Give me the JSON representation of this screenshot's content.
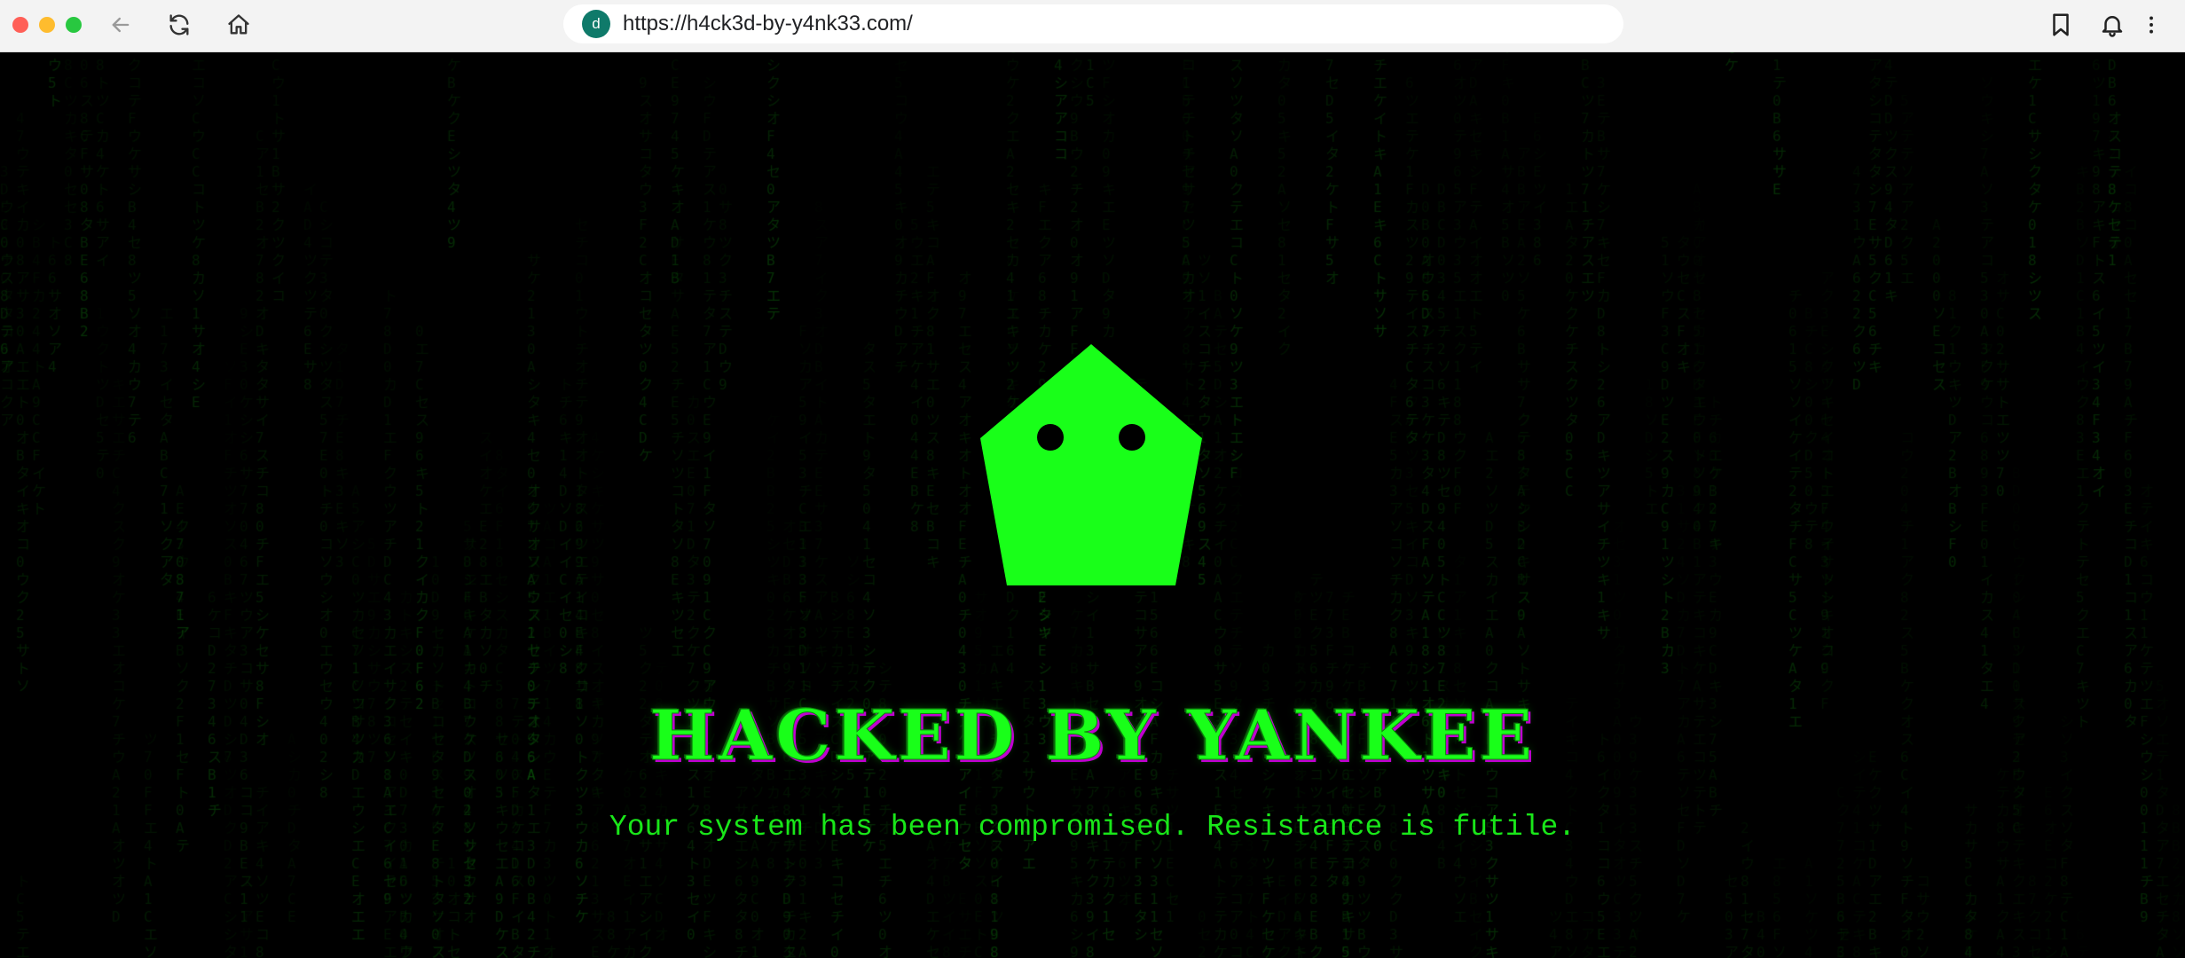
{
  "browser": {
    "address_bar": {
      "favicon_letter": "d",
      "url": "https://h4ck3d-by-y4nk33.com/"
    },
    "icons": {
      "back": "arrow-left-icon",
      "reload": "reload-icon",
      "home": "home-icon",
      "bookmark": "bookmark-icon",
      "notifications": "bell-icon",
      "menu": "more-vertical-icon"
    }
  },
  "page": {
    "headline": "HACKED BY YANKEE",
    "message": "Your system has been compromised. Resistance is futile.",
    "logo_icon": "pentagon-face-icon",
    "colors": {
      "background": "#000000",
      "accent_green": "#19ff19",
      "headline_shadow": "#c000d0",
      "rain_green": "#0d6b0d"
    }
  }
}
